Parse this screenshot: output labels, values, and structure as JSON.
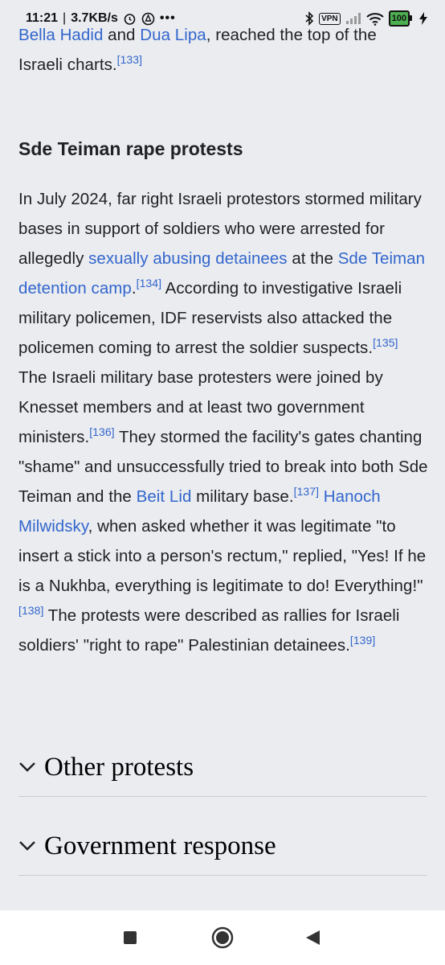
{
  "status_bar": {
    "time": "11:21",
    "speed": "3.7KB/s",
    "vpn": "VPN",
    "battery": "100"
  },
  "article": {
    "top_fragment": {
      "link1": "Bella Hadid",
      "and": " and ",
      "link2": "Dua Lipa",
      "tail": ", reached the top of the",
      "line2": "Israeli charts.",
      "ref": "[133]"
    },
    "section_title": "Sde Teiman rape protests",
    "para": {
      "t1": "In July 2024, far right Israeli protestors stormed military bases in support of soldiers who were arrested for allegedly ",
      "l1": "sexually abusing detainees",
      "t2": " at the ",
      "l2": "Sde Teiman detention camp",
      "t3": ".",
      "r1": "[134]",
      "t4": " According to investigative Israeli military policemen, IDF reservists also attacked the policemen coming to arrest the soldier suspects.",
      "r2": "[135]",
      "t5": " The Israeli military base protesters were joined by Knesset members and at least two government ministers.",
      "r3": "[136]",
      "t6": " They stormed the facility's gates chanting \"shame\" and unsuccessfully tried to break into both Sde Teiman and the ",
      "l3": "Beit Lid",
      "t7": " military base.",
      "r4": "[137]",
      "t8": " ",
      "l4": "Hanoch Milwidsky",
      "t9": ", when asked whether it was legitimate \"to insert a stick into a person's rectum,\" replied, \"Yes! If he is a Nukhba, everything is legitimate to do! Everything!\"",
      "r5": "[138]",
      "t10": " The protests were described as rallies for Israeli soldiers' \"right to rape\" Palestinian detainees.",
      "r6": "[139]"
    },
    "collapsed_sections": [
      {
        "label": "Other protests",
        "icon": "chevron-down-icon"
      },
      {
        "label": "Government response",
        "icon": "chevron-down-icon"
      }
    ]
  },
  "nav_bar": {
    "recents_icon": "square-icon",
    "home_icon": "circle-icon",
    "back_icon": "triangle-back-icon"
  },
  "colors": {
    "link": "#3366cc",
    "visited_link": "#5b4e9a",
    "background": "#eaecf0"
  }
}
